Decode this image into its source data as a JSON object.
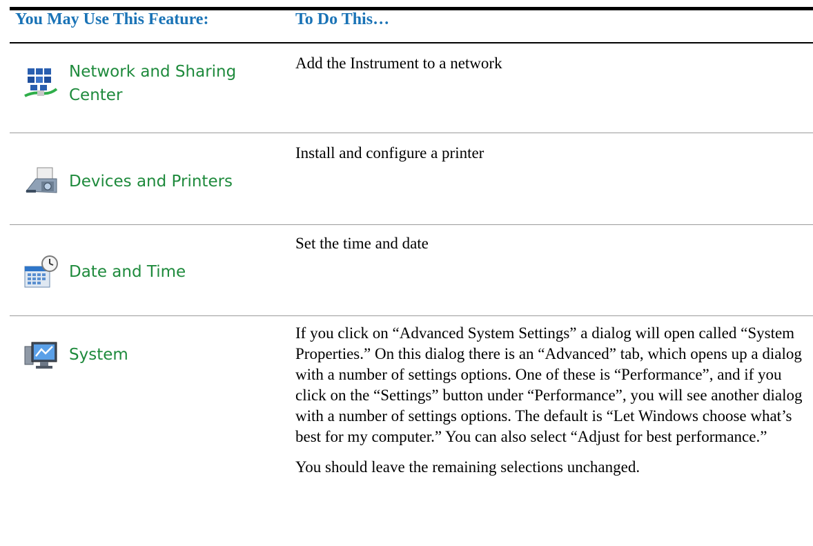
{
  "header": {
    "col1": "You May Use This Feature:",
    "col2": "To Do This…"
  },
  "rows": [
    {
      "feature": "Network and Sharing Center",
      "feature_line1": "Network and Sharing",
      "feature_line2": "Center",
      "icon": "network-sharing-icon",
      "description": "Add the Instrument to a network"
    },
    {
      "feature": "Devices and Printers",
      "icon": "printer-icon",
      "description": "Install and configure a printer"
    },
    {
      "feature": "Date and Time",
      "icon": "calendar-clock-icon",
      "description": "Set the time and date"
    },
    {
      "feature": "System",
      "icon": "computer-monitor-icon",
      "paragraphs": [
        "If you click on “Advanced System Settings” a dialog will open called “System Properties.” On this dialog there is an “Advanced” tab, which opens up a dialog with a number of settings options. One of these is “Performance”, and if you click on the “Settings” button under “Performance”, you will see another dialog with a number of settings options.   The default is “Let Windows choose what’s best for my computer.” You can also select “Adjust for best performance.”",
        "You should leave the remaining selections unchanged."
      ]
    }
  ],
  "colors": {
    "header_text": "#1a73b6",
    "feature_text": "#1e8a3c"
  }
}
